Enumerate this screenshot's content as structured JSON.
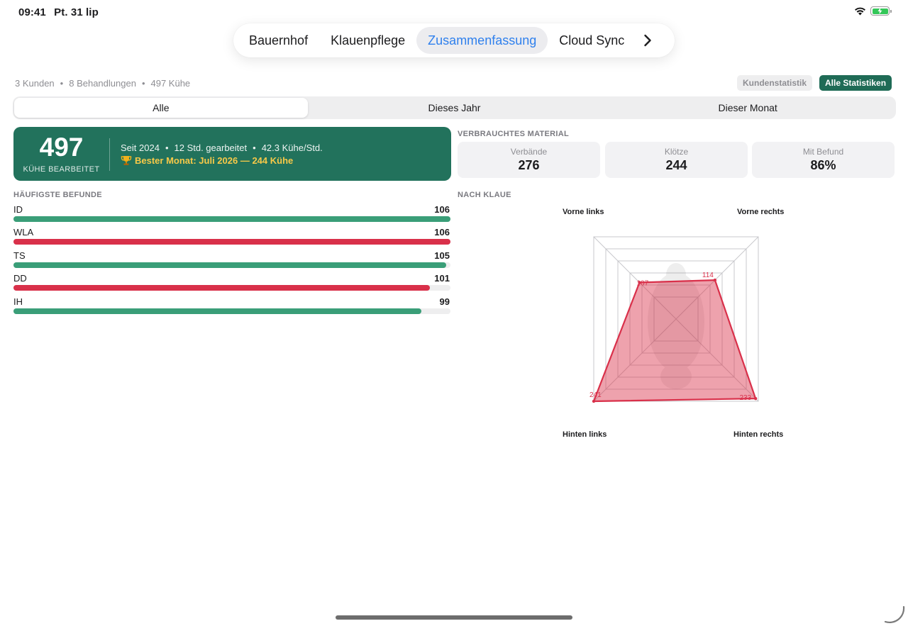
{
  "status_bar": {
    "time": "09:41",
    "date": "Pt. 31 lip"
  },
  "nav": {
    "tabs": [
      {
        "label": "Bauernhof",
        "active": false
      },
      {
        "label": "Klauenpflege",
        "active": false
      },
      {
        "label": "Zusammenfassung",
        "active": true
      },
      {
        "label": "Cloud Sync",
        "active": false
      }
    ]
  },
  "summary": {
    "customers": "3 Kunden",
    "treatments": "8 Behandlungen",
    "cows": "497 Kühe",
    "separator": "•"
  },
  "buttons": {
    "kundenstatistik": "Kundenstatistik",
    "alle_statistiken": "Alle Statistiken"
  },
  "segment": {
    "options": [
      "Alle",
      "Dieses Jahr",
      "Dieser Monat"
    ],
    "selected": "Alle"
  },
  "hero": {
    "count": "497",
    "label": "KÜHE BEARBEITET",
    "since": "Seit 2024",
    "hours": "12 Std. gearbeitet",
    "rate": "42.3 Kühe/Std.",
    "best_month": "Bester Monat: Juli 2026 — 244 Kühe",
    "best_month_icon": "trophy-icon"
  },
  "material": {
    "title": "VERBRAUCHTES MATERIAL",
    "items": [
      {
        "label": "Verbände",
        "value": "276"
      },
      {
        "label": "Klötze",
        "value": "244"
      },
      {
        "label": "Mit Befund",
        "value": "86%"
      }
    ]
  },
  "findings": {
    "title": "HÄUFIGSTE BEFUNDE",
    "max": 106,
    "items": [
      {
        "name": "ID",
        "value": 106,
        "color": "#3a9e78"
      },
      {
        "name": "WLA",
        "value": 106,
        "color": "#d9304a"
      },
      {
        "name": "TS",
        "value": 105,
        "color": "#3a9e78"
      },
      {
        "name": "DD",
        "value": 101,
        "color": "#d9304a"
      },
      {
        "name": "IH",
        "value": 99,
        "color": "#3a9e78"
      }
    ]
  },
  "claws": {
    "title": "NACH KLAUE",
    "labels": {
      "front_left": "Vorne links",
      "front_right": "Vorne rechts",
      "rear_left": "Hinten links",
      "rear_right": "Hinten rechts"
    },
    "chart_data": {
      "type": "radar",
      "categories": [
        "Vorne links",
        "Vorne rechts",
        "Hinten rechts",
        "Hinten links"
      ],
      "values": [
        107,
        114,
        233,
        241
      ],
      "max": 241,
      "color": "#d9304a"
    }
  },
  "colors": {
    "accent": "#2f80ed",
    "brand_green": "#22725c",
    "gold": "#f7c948",
    "red": "#d9304a",
    "green_bar": "#3a9e78"
  }
}
